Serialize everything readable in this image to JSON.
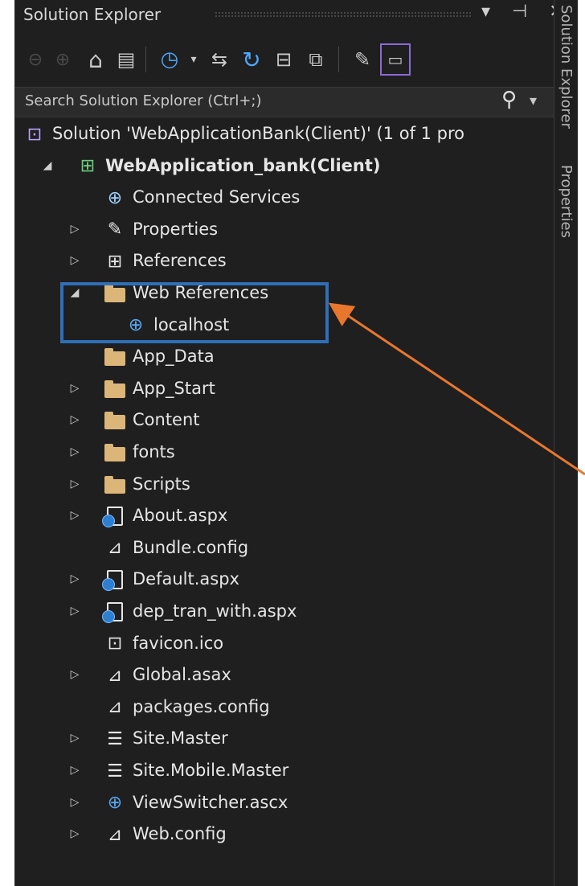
{
  "window": {
    "title": "Solution Explorer",
    "title_icons": "▾ ⊣ ✕"
  },
  "toolbar": {
    "icons": [
      "back-icon",
      "forward-icon",
      "home-icon",
      "vs-switch-view-icon",
      "pending-changes-icon",
      "dropdown-icon",
      "sync-icon",
      "refresh-icon",
      "collapse-all-icon",
      "show-all-files-icon",
      "properties-wrench-icon",
      "preview-selected-icon"
    ]
  },
  "search": {
    "placeholder": "Search Solution Explorer (Ctrl+;)",
    "icon": "search-icon"
  },
  "side_tabs": [
    "Solution Explorer",
    "Properties"
  ],
  "tree": [
    {
      "label": "Solution 'WebApplicationBank(Client)' (1 of 1 pro",
      "icon": "solution-icon",
      "expander": "",
      "indent": 0,
      "bold": false
    },
    {
      "label": "WebApplication_bank(Client)",
      "icon": "web-project-icon",
      "expander": "expanded",
      "indent": 1,
      "bold": true
    },
    {
      "label": "Connected Services",
      "icon": "connected-services-icon",
      "expander": "",
      "indent": 2,
      "bold": false
    },
    {
      "label": "Properties",
      "icon": "wrench-icon",
      "expander": "collapsed",
      "indent": 2,
      "bold": false
    },
    {
      "label": "References",
      "icon": "references-icon",
      "expander": "collapsed",
      "indent": 2,
      "bold": false
    },
    {
      "label": "Web References",
      "icon": "folder-icon",
      "expander": "expanded",
      "indent": 2,
      "bold": false
    },
    {
      "label": "localhost",
      "icon": "web-reference-icon",
      "expander": "",
      "indent": 3,
      "bold": false
    },
    {
      "label": "App_Data",
      "icon": "folder-icon",
      "expander": "",
      "indent": 2,
      "bold": false
    },
    {
      "label": "App_Start",
      "icon": "folder-icon",
      "expander": "collapsed",
      "indent": 2,
      "bold": false
    },
    {
      "label": "Content",
      "icon": "folder-icon",
      "expander": "collapsed",
      "indent": 2,
      "bold": false
    },
    {
      "label": "fonts",
      "icon": "folder-icon",
      "expander": "collapsed",
      "indent": 2,
      "bold": false
    },
    {
      "label": "Scripts",
      "icon": "folder-icon",
      "expander": "collapsed",
      "indent": 2,
      "bold": false
    },
    {
      "label": "About.aspx",
      "icon": "aspx-file-icon",
      "expander": "collapsed",
      "indent": 2,
      "bold": false
    },
    {
      "label": "Bundle.config",
      "icon": "config-file-icon",
      "expander": "",
      "indent": 2,
      "bold": false
    },
    {
      "label": "Default.aspx",
      "icon": "aspx-file-icon",
      "expander": "collapsed",
      "indent": 2,
      "bold": false
    },
    {
      "label": "dep_tran_with.aspx",
      "icon": "aspx-file-icon",
      "expander": "collapsed",
      "indent": 2,
      "bold": false
    },
    {
      "label": "favicon.ico",
      "icon": "ico-file-icon",
      "expander": "",
      "indent": 2,
      "bold": false
    },
    {
      "label": "Global.asax",
      "icon": "asax-file-icon",
      "expander": "collapsed",
      "indent": 2,
      "bold": false
    },
    {
      "label": "packages.config",
      "icon": "config-file-icon",
      "expander": "",
      "indent": 2,
      "bold": false
    },
    {
      "label": "Site.Master",
      "icon": "master-page-icon",
      "expander": "collapsed",
      "indent": 2,
      "bold": false
    },
    {
      "label": "Site.Mobile.Master",
      "icon": "master-page-icon",
      "expander": "collapsed",
      "indent": 2,
      "bold": false
    },
    {
      "label": "ViewSwitcher.ascx",
      "icon": "user-control-icon",
      "expander": "collapsed",
      "indent": 2,
      "bold": false
    },
    {
      "label": "Web.config",
      "icon": "config-file-icon",
      "expander": "collapsed",
      "indent": 2,
      "bold": false
    }
  ],
  "annotation": {
    "box_color": "#2f6fb8",
    "arrow_color": "#e8772e"
  },
  "colors": {
    "background": "#1f1f1f",
    "text": "#e6e6e6",
    "folder": "#dcb679",
    "accent": "#8c6bd6"
  }
}
